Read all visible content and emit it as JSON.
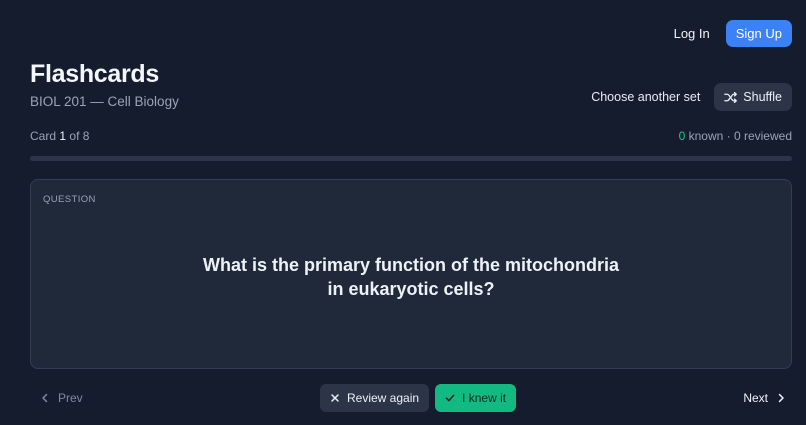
{
  "header": {
    "login_label": "Log In",
    "signup_label": "Sign Up"
  },
  "deck": {
    "title": "Flashcards",
    "subtitle": "BIOL 201 — Cell Biology"
  },
  "actions": {
    "choose_label": "Choose another set",
    "shuffle_label": "Shuffle"
  },
  "progress": {
    "card_prefix": "Card",
    "current": "1",
    "of_text": "of 8",
    "known_count": "0",
    "known_text": "known · 0 reviewed",
    "fraction": 0
  },
  "card": {
    "label": "QUESTION",
    "text": "What is the primary function of the mitochondria in eukaryotic cells?"
  },
  "nav": {
    "prev_label": "Prev",
    "review_label": "Review again",
    "knew_label": "I knew it",
    "next_label": "Next"
  },
  "colors": {
    "background": "#141c2e",
    "accent": "#3b82f6",
    "success": "#12b981"
  },
  "icons": [
    "shuffle-icon",
    "chevron-left-icon",
    "close-icon",
    "check-icon",
    "chevron-right-icon"
  ]
}
